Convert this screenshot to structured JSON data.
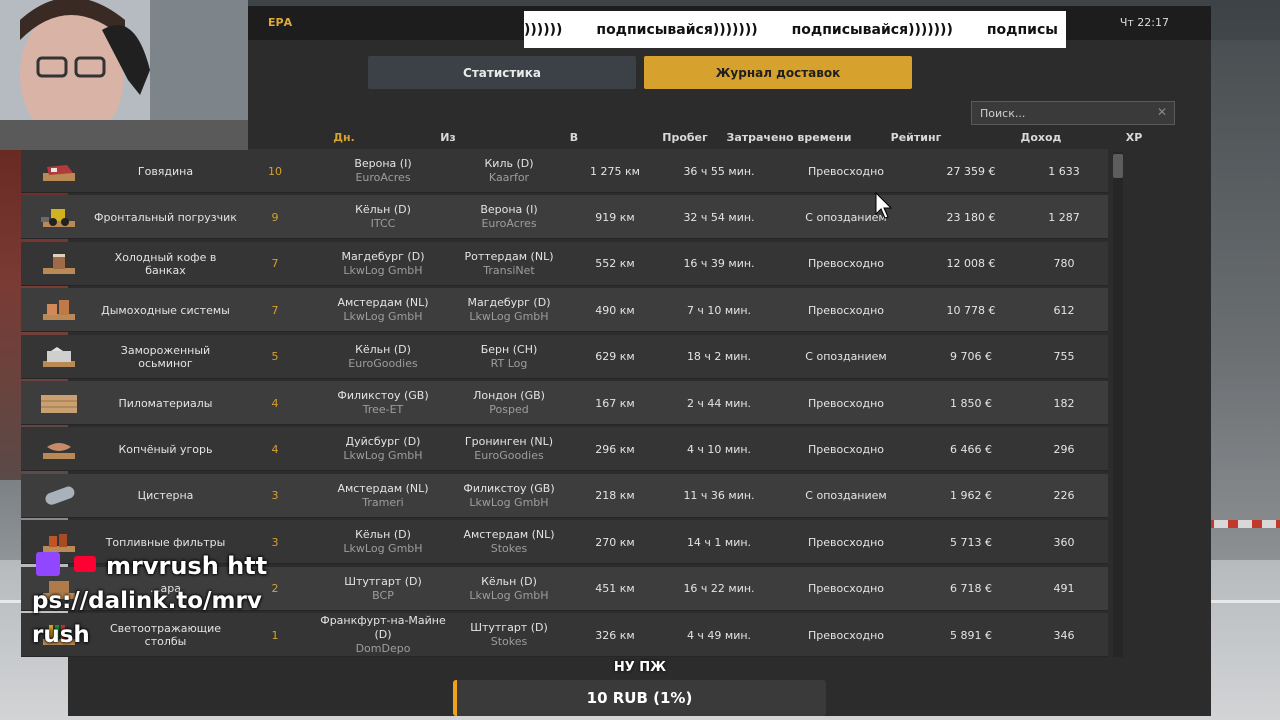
{
  "window": {
    "title_fragment": "ЕРА",
    "clock": "Чт 22:17"
  },
  "tabs": [
    {
      "label": "Статистика",
      "active": false
    },
    {
      "label": "Журнал доставок",
      "active": true
    }
  ],
  "search": {
    "placeholder": "Поиск..."
  },
  "columns": {
    "days": "Дн.",
    "from": "Из",
    "to": "В",
    "distance": "Пробег",
    "time": "Затрачено времени",
    "rating": "Рейтинг",
    "income": "Доход",
    "xp": "XP"
  },
  "rows": [
    {
      "cargo": "Говядина",
      "icon": "meat-cargo-icon",
      "days": "10",
      "from_city": "Верона (I)",
      "from_company": "EuroAcres",
      "to_city": "Киль (D)",
      "to_company": "Kaarfor",
      "distance": "1 275 км",
      "time": "36 ч 55 мин.",
      "rating": "Превосходно",
      "income": "27 359 €",
      "xp": "1 633"
    },
    {
      "cargo": "Фронтальный погрузчик",
      "icon": "loader-cargo-icon",
      "days": "9",
      "from_city": "Кёльн (D)",
      "from_company": "ITCC",
      "to_city": "Верона (I)",
      "to_company": "EuroAcres",
      "distance": "919 км",
      "time": "32 ч 54 мин.",
      "rating": "С опозданием",
      "income": "23 180 €",
      "xp": "1 287"
    },
    {
      "cargo": "Холодный кофе в банках",
      "icon": "coffee-cargo-icon",
      "days": "7",
      "from_city": "Магдебург (D)",
      "from_company": "LkwLog GmbH",
      "to_city": "Роттердам (NL)",
      "to_company": "TransiNet",
      "distance": "552 км",
      "time": "16 ч 39 мин.",
      "rating": "Превосходно",
      "income": "12 008 €",
      "xp": "780"
    },
    {
      "cargo": "Дымоходные системы",
      "icon": "chimney-cargo-icon",
      "days": "7",
      "from_city": "Амстердам (NL)",
      "from_company": "LkwLog GmbH",
      "to_city": "Магдебург (D)",
      "to_company": "LkwLog GmbH",
      "distance": "490 км",
      "time": "7 ч 10 мин.",
      "rating": "Превосходно",
      "income": "10 778 €",
      "xp": "612"
    },
    {
      "cargo": "Замороженный осьминог",
      "icon": "octopus-cargo-icon",
      "days": "5",
      "from_city": "Кёльн (D)",
      "from_company": "EuroGoodies",
      "to_city": "Берн (CH)",
      "to_company": "RT Log",
      "distance": "629 км",
      "time": "18 ч 2 мин.",
      "rating": "С опозданием",
      "income": "9 706 €",
      "xp": "755"
    },
    {
      "cargo": "Пиломатериалы",
      "icon": "lumber-cargo-icon",
      "days": "4",
      "from_city": "Филикстоу (GB)",
      "from_company": "Tree-ET",
      "to_city": "Лондон (GB)",
      "to_company": "Posped",
      "distance": "167 км",
      "time": "2 ч 44 мин.",
      "rating": "Превосходно",
      "income": "1 850 €",
      "xp": "182"
    },
    {
      "cargo": "Копчёный угорь",
      "icon": "fish-cargo-icon",
      "days": "4",
      "from_city": "Дуйсбург (D)",
      "from_company": "LkwLog GmbH",
      "to_city": "Гронинген (NL)",
      "to_company": "EuroGoodies",
      "distance": "296 км",
      "time": "4 ч 10 мин.",
      "rating": "Превосходно",
      "income": "6 466 €",
      "xp": "296"
    },
    {
      "cargo": "Цистерна",
      "icon": "tank-cargo-icon",
      "days": "3",
      "from_city": "Амстердам (NL)",
      "from_company": "Trameri",
      "to_city": "Филикстоу (GB)",
      "to_company": "LkwLog GmbH",
      "distance": "218 км",
      "time": "11 ч 36 мин.",
      "rating": "С опозданием",
      "income": "1 962 €",
      "xp": "226"
    },
    {
      "cargo": "Топливные фильтры",
      "icon": "filter-cargo-icon",
      "days": "3",
      "from_city": "Кёльн (D)",
      "from_company": "LkwLog GmbH",
      "to_city": "Амстердам (NL)",
      "to_company": "Stokes",
      "distance": "270 км",
      "time": "14 ч 1 мин.",
      "rating": "Превосходно",
      "income": "5 713 €",
      "xp": "360"
    },
    {
      "cargo": "...ара",
      "icon": "box-cargo-icon",
      "days": "2",
      "from_city": "Штутгарт (D)",
      "from_company": "BCP",
      "to_city": "Кёльн (D)",
      "to_company": "LkwLog GmbH",
      "distance": "451 км",
      "time": "16 ч 22 мин.",
      "rating": "Превосходно",
      "income": "6 718 €",
      "xp": "491"
    },
    {
      "cargo": "Светоотражающие столбы",
      "icon": "posts-cargo-icon",
      "days": "1",
      "from_city": "Франкфурт-на-Майне (D)",
      "from_company": "DomDepo",
      "to_city": "Штутгарт (D)",
      "to_company": "Stokes",
      "distance": "326 км",
      "time": "4 ч 49 мин.",
      "rating": "Превосходно",
      "income": "5 891 €",
      "xp": "346"
    }
  ],
  "overlay": {
    "ticker": [
      "))))))",
      "подписывайся)))))))",
      "подписывайся)))))))",
      "подписы"
    ],
    "social_line1": "mrvrush htt",
    "social_line2": "ps://dalink.to/mrv",
    "social_line3": "rush",
    "donate_title": "НУ ПЖ",
    "donate_label": "10 RUB (1%)",
    "donate_progress": 0.01
  },
  "colors": {
    "accent": "#d7a12e",
    "panel": "#2c2c2c",
    "row": "#353535",
    "row_alt": "#3d3d3d",
    "donate": "#f0a21b"
  }
}
